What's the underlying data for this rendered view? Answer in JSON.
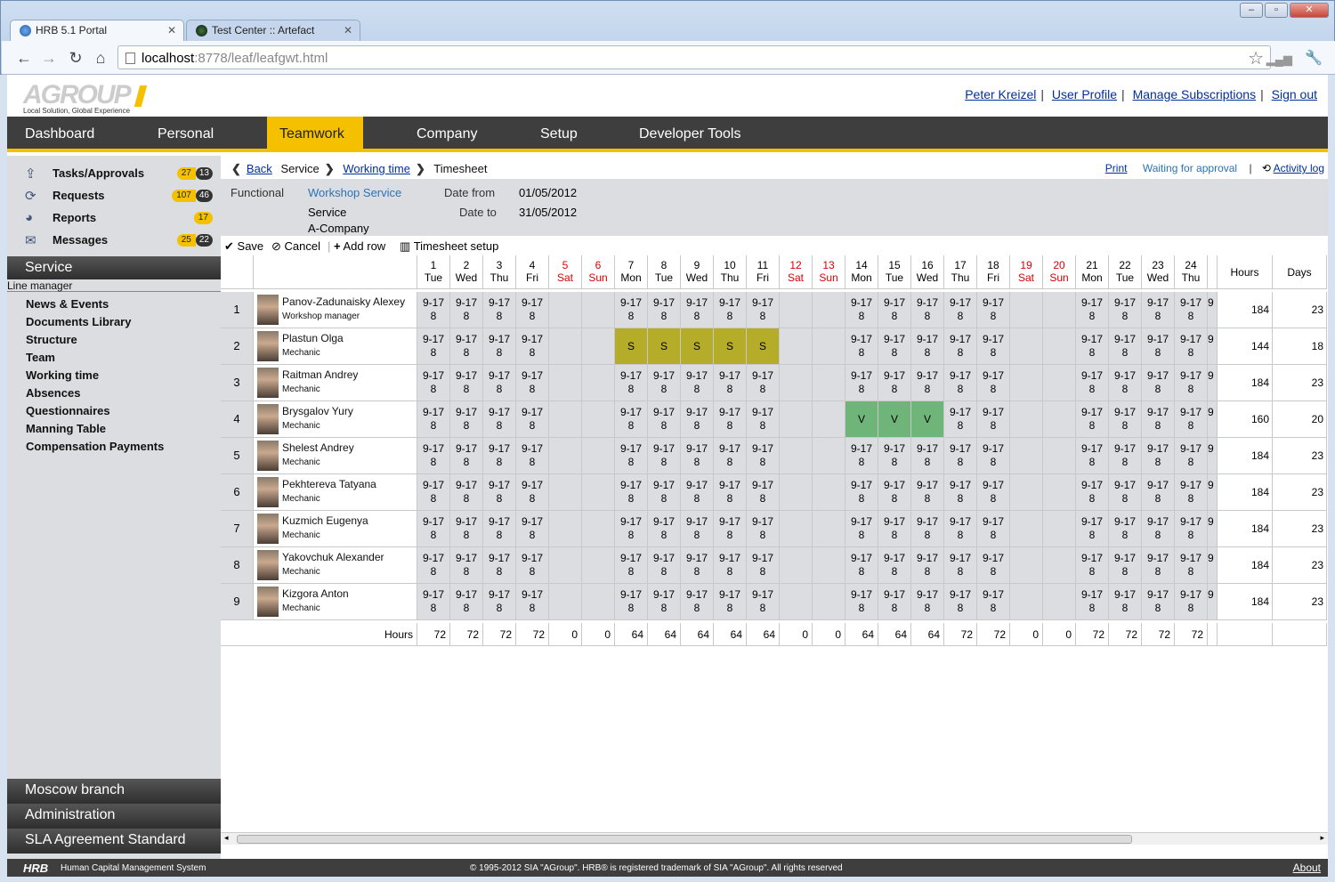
{
  "browser": {
    "tabs": [
      {
        "label": "HRB 5.1 Portal"
      },
      {
        "label": "Test Center :: Artefact"
      }
    ],
    "url_host": "localhost",
    "url_rest": ":8778/leaf/leafgwt.html"
  },
  "header": {
    "logo_text": "AGROUP",
    "logo_tagline": "Local Solution, Global Experience",
    "user_links": [
      "Peter Kreizel",
      "User Profile",
      "Manage Subscriptions",
      "Sign out"
    ]
  },
  "nav": {
    "items": [
      "Dashboard",
      "Personal",
      "Teamwork",
      "Company",
      "Setup",
      "Developer Tools"
    ],
    "active": "Teamwork"
  },
  "sidebar": {
    "shortcuts": [
      {
        "label": "Tasks/Approvals",
        "icon": "share-icon",
        "b1": "27",
        "b2": "13"
      },
      {
        "label": "Requests",
        "icon": "refresh-icon",
        "b1": "107",
        "b2": "46"
      },
      {
        "label": "Reports",
        "icon": "pie-chart-icon",
        "b1": "17",
        "b2": ""
      },
      {
        "label": "Messages",
        "icon": "envelope-icon",
        "b1": "25",
        "b2": "22"
      }
    ],
    "section": "Service",
    "line_manager": "Line manager",
    "links": [
      "News & Events",
      "Documents Library",
      "Structure",
      "Team",
      "Working time",
      "Absences",
      "Questionnaires",
      "Manning Table",
      "Compensation Payments"
    ],
    "bottom_sections": [
      "Moscow branch",
      "Administration",
      "SLA Agreement Standard"
    ]
  },
  "breadcrumb": {
    "back": "Back",
    "service": "Service",
    "working_time": "Working time",
    "current": "Timesheet"
  },
  "topright": {
    "print": "Print",
    "status": "Waiting for approval",
    "activity": "Activity log"
  },
  "info": {
    "functional_label": "Functional",
    "functional_value": "Workshop Service",
    "service": "Service",
    "company": "A-Company",
    "date_from_label": "Date from",
    "date_from": "01/05/2012",
    "date_to_label": "Date to",
    "date_to": "31/05/2012"
  },
  "actions": {
    "save": "Save",
    "cancel": "Cancel",
    "add_row": "Add row",
    "setup": "Timesheet setup"
  },
  "timesheet": {
    "days": [
      {
        "n": "1",
        "d": "Tue"
      },
      {
        "n": "2",
        "d": "Wed"
      },
      {
        "n": "3",
        "d": "Thu"
      },
      {
        "n": "4",
        "d": "Fri"
      },
      {
        "n": "5",
        "d": "Sat",
        "we": true
      },
      {
        "n": "6",
        "d": "Sun",
        "we": true
      },
      {
        "n": "7",
        "d": "Mon"
      },
      {
        "n": "8",
        "d": "Tue"
      },
      {
        "n": "9",
        "d": "Wed"
      },
      {
        "n": "10",
        "d": "Thu"
      },
      {
        "n": "11",
        "d": "Fri"
      },
      {
        "n": "12",
        "d": "Sat",
        "we": true
      },
      {
        "n": "13",
        "d": "Sun",
        "we": true
      },
      {
        "n": "14",
        "d": "Mon"
      },
      {
        "n": "15",
        "d": "Tue"
      },
      {
        "n": "16",
        "d": "Wed"
      },
      {
        "n": "17",
        "d": "Thu"
      },
      {
        "n": "18",
        "d": "Fri"
      },
      {
        "n": "19",
        "d": "Sat",
        "we": true
      },
      {
        "n": "20",
        "d": "Sun",
        "we": true
      },
      {
        "n": "21",
        "d": "Mon"
      },
      {
        "n": "22",
        "d": "Tue"
      },
      {
        "n": "23",
        "d": "Wed"
      },
      {
        "n": "24",
        "d": "Thu"
      }
    ],
    "hours_header": "Hours",
    "days_header": "Days",
    "work_time": "9-17",
    "work_hours": "8",
    "overflow_digit": "9",
    "employees": [
      {
        "num": "1",
        "name": "Panov-Zadunaisky Alexey",
        "role": "Workshop manager",
        "hours": "184",
        "days": "23",
        "marks": {}
      },
      {
        "num": "2",
        "name": "Plastun Olga",
        "role": "Mechanic",
        "hours": "144",
        "days": "18",
        "marks": {
          "7": "S",
          "8": "S",
          "9": "S",
          "10": "S",
          "11": "S"
        }
      },
      {
        "num": "3",
        "name": "Raitman Andrey",
        "role": "Mechanic",
        "hours": "184",
        "days": "23",
        "marks": {}
      },
      {
        "num": "4",
        "name": "Brysgalov Yury",
        "role": "Mechanic",
        "hours": "160",
        "days": "20",
        "marks": {
          "14": "V",
          "15": "V",
          "16": "V"
        }
      },
      {
        "num": "5",
        "name": "Shelest Andrey",
        "role": "Mechanic",
        "hours": "184",
        "days": "23",
        "marks": {}
      },
      {
        "num": "6",
        "name": "Pekhtereva Tatyana",
        "role": "Mechanic",
        "hours": "184",
        "days": "23",
        "marks": {}
      },
      {
        "num": "7",
        "name": "Kuzmich Eugenya",
        "role": "Mechanic",
        "hours": "184",
        "days": "23",
        "marks": {}
      },
      {
        "num": "8",
        "name": "Yakovchuk Alexander",
        "role": "Mechanic",
        "hours": "184",
        "days": "23",
        "marks": {}
      },
      {
        "num": "9",
        "name": "Kizgora Anton",
        "role": "Mechanic",
        "hours": "184",
        "days": "23",
        "marks": {}
      }
    ],
    "totals_label": "Hours",
    "totals": [
      "72",
      "72",
      "72",
      "72",
      "0",
      "0",
      "64",
      "64",
      "64",
      "64",
      "64",
      "0",
      "0",
      "64",
      "64",
      "64",
      "72",
      "72",
      "0",
      "0",
      "72",
      "72",
      "72",
      "72"
    ]
  },
  "footer": {
    "brand": "HRB",
    "system": "Human Capital Management System",
    "copyright": "© 1995-2012 SIA \"AGroup\". HRB® is registered trademark of SIA \"AGroup\". All rights reserved",
    "about": "About"
  },
  "colors": {
    "accent": "#f5c000",
    "nav_bg": "#3e3e3e",
    "sick": "#b5ac2a",
    "vacation": "#6fb57a",
    "weekend_red": "#d00000",
    "link": "#00309a"
  }
}
